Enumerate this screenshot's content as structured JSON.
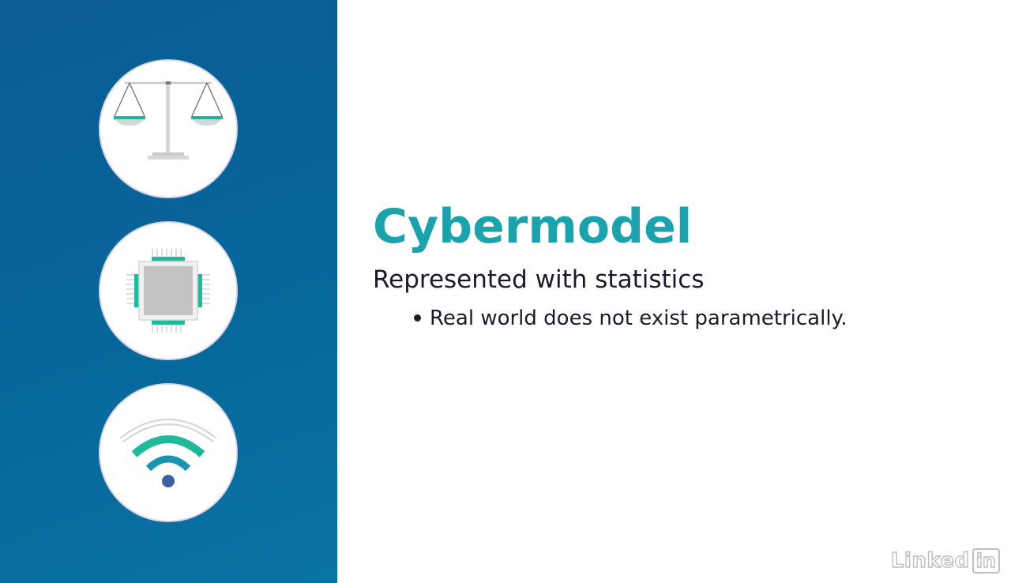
{
  "slide": {
    "title": "Cybermodel",
    "subtitle": "Represented with statistics",
    "bullets": [
      "Real world does not exist parametrically."
    ]
  },
  "icons": [
    "balance-scale-icon",
    "microchip-icon",
    "wifi-icon"
  ],
  "logo": {
    "text": "Linked",
    "box_text": "in"
  },
  "colors": {
    "panel": "#07679a",
    "title": "#1ba3ad",
    "text": "#1a1a2e",
    "icon_teal": "#1fb99b",
    "icon_blue": "#1a93b0",
    "icon_dot": "#3d5fa8"
  }
}
